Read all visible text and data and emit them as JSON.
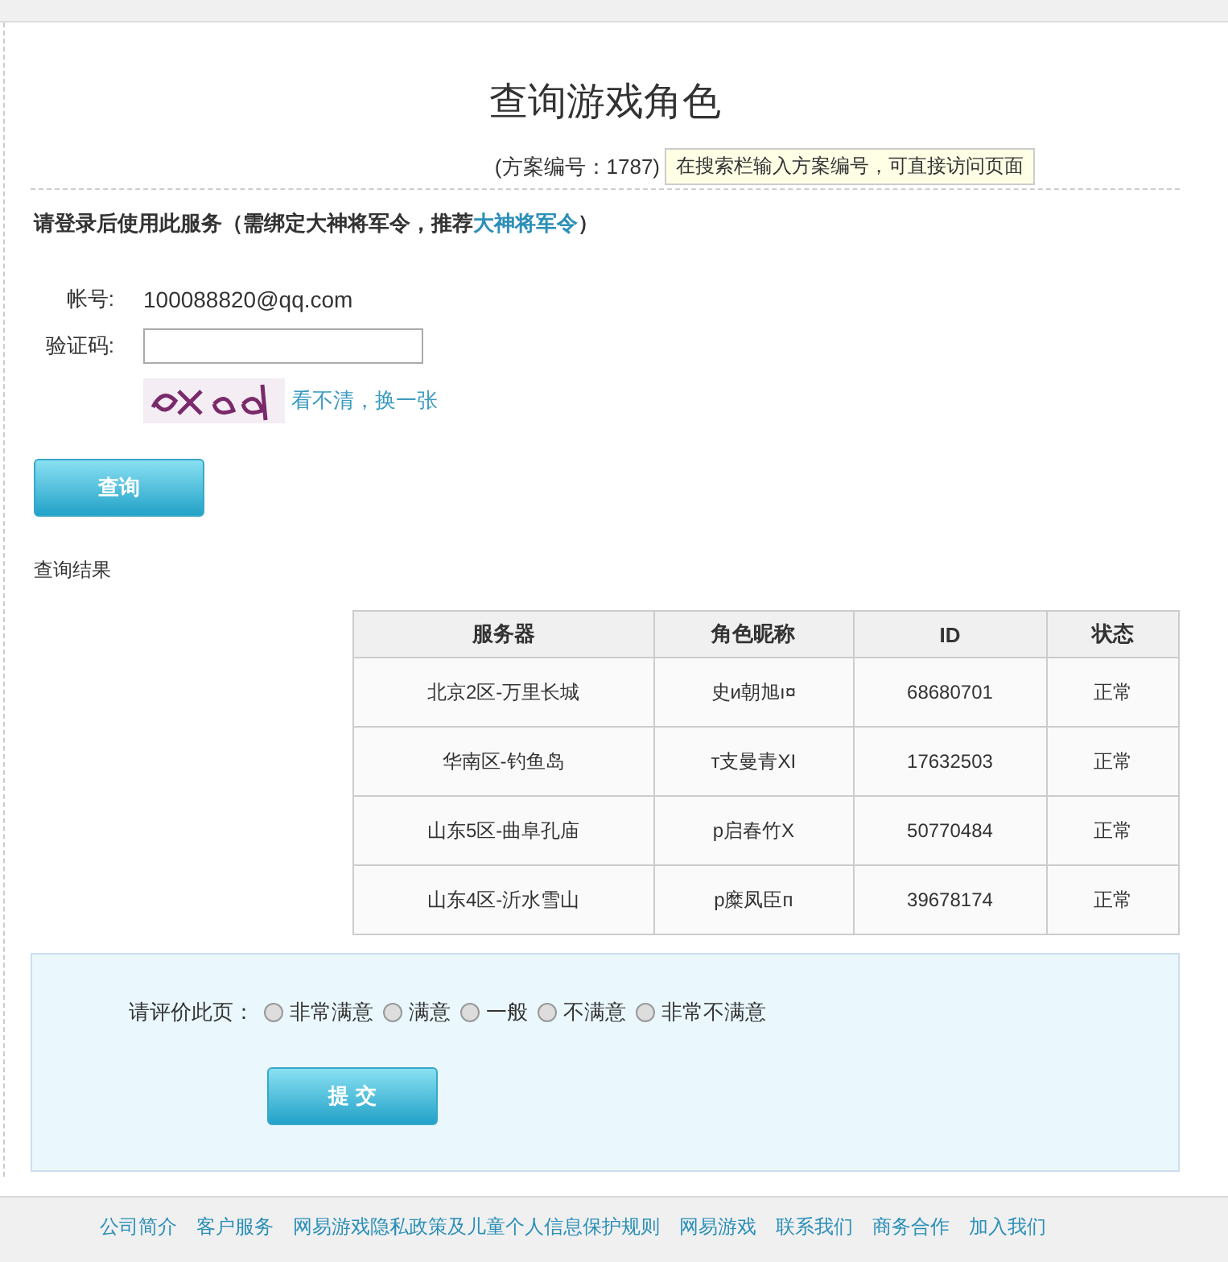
{
  "page": {
    "title": "查询游戏角色",
    "plan_number": "(方案编号：1787)",
    "plan_tip": "在搜索栏输入方案编号，可直接访问页面"
  },
  "notice": {
    "text": "请登录后使用此服务（需绑定大神将军令，推荐",
    "link": "大神将军令",
    "suffix": "）"
  },
  "form": {
    "account_label": "帐号:",
    "account_value": "100088820@qq.com",
    "captcha_label": "验证码:",
    "captcha_refresh": "看不清，换一张",
    "submit": "查询"
  },
  "results": {
    "label": "查询结果",
    "columns": [
      "服务器",
      "角色昵称",
      "ID",
      "状态"
    ],
    "rows": [
      [
        "北京2区-万里长城",
        "史и朝旭ı¤",
        "68680701",
        "正常"
      ],
      [
        "华南区-钓鱼岛",
        "т支曼青XI",
        "17632503",
        "正常"
      ],
      [
        "山东5区-曲阜孔庙",
        "p启春竹X",
        "50770484",
        "正常"
      ],
      [
        "山东4区-沂水雪山",
        "p糜凤臣п",
        "39678174",
        "正常"
      ]
    ]
  },
  "rating": {
    "label": "请评价此页：",
    "options": [
      {
        "label": "非常满意",
        "selected": false
      },
      {
        "label": "满意",
        "selected": false
      },
      {
        "label": "一般",
        "selected": false
      },
      {
        "label": "不满意",
        "selected": false
      },
      {
        "label": "非常不满意",
        "selected": false
      }
    ],
    "submit": "提 交"
  },
  "footer": {
    "links": [
      "公司简介",
      "客户服务",
      "网易游戏隐私政策及儿童个人信息保护规则",
      "网易游戏",
      "联系我们",
      "商务合作",
      "加入我们"
    ]
  }
}
